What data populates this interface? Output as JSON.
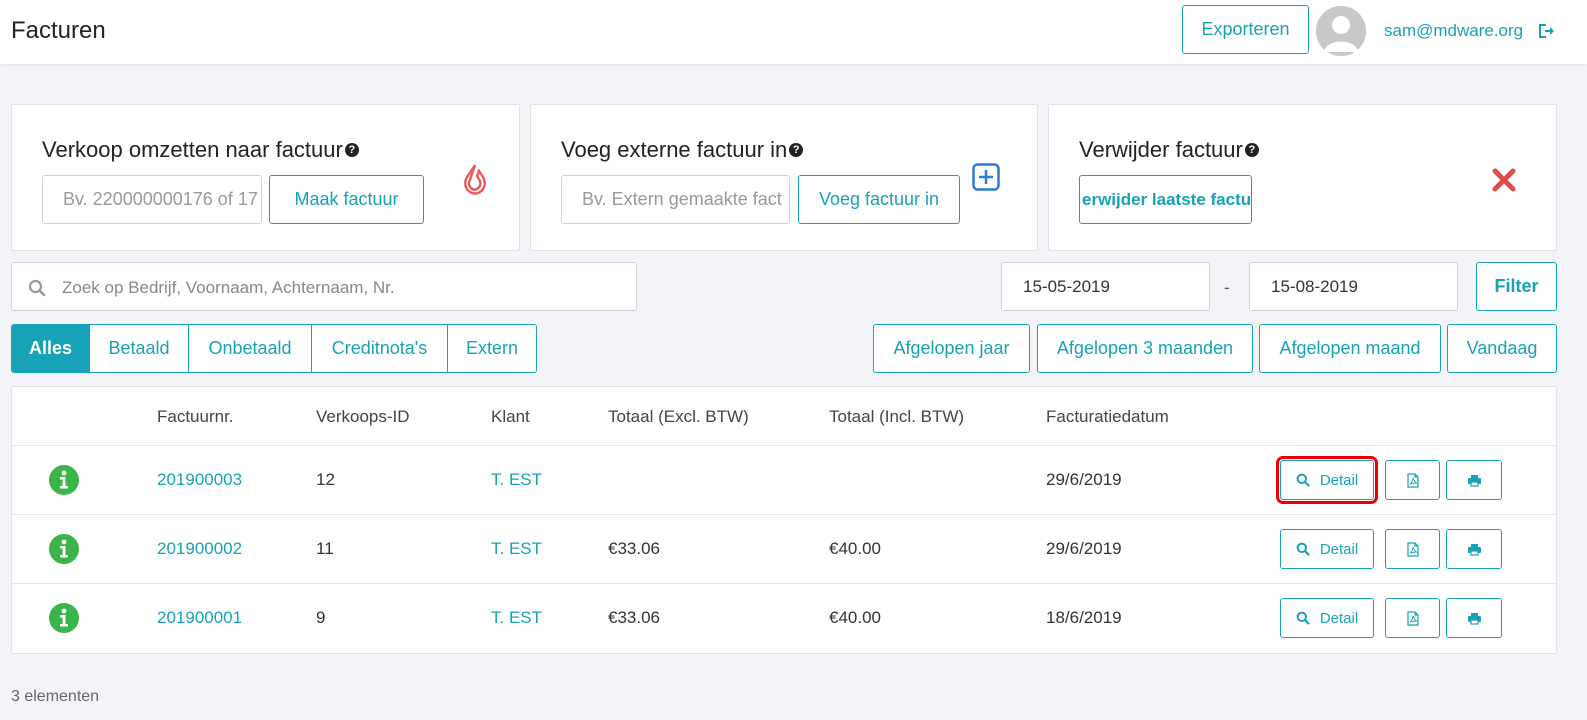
{
  "header": {
    "title": "Facturen",
    "export_label": "Exporteren",
    "user_email": "sam@mdware.org"
  },
  "cards": {
    "convert": {
      "title": "Verkoop omzetten naar factuur",
      "placeholder": "Bv. 220000000176 of 17",
      "button": "Maak factuur"
    },
    "external": {
      "title": "Voeg externe factuur in",
      "placeholder": "Bv. Extern gemaakte fact",
      "button": "Voeg factuur in"
    },
    "delete": {
      "title": "Verwijder factuur",
      "button": "erwijder laatste factuu"
    }
  },
  "search": {
    "placeholder": "Zoek op Bedrijf, Voornaam, Achternaam, Nr."
  },
  "date_filter": {
    "from": "15-05-2019",
    "separator": "-",
    "to": "15-08-2019",
    "filter_label": "Filter"
  },
  "tabs": [
    {
      "label": "Alles",
      "active": true
    },
    {
      "label": "Betaald",
      "active": false
    },
    {
      "label": "Onbetaald",
      "active": false
    },
    {
      "label": "Creditnota's",
      "active": false
    },
    {
      "label": "Extern",
      "active": false
    }
  ],
  "ranges": [
    "Afgelopen jaar",
    "Afgelopen 3 maanden",
    "Afgelopen maand",
    "Vandaag"
  ],
  "table": {
    "headers": [
      "Factuurnr.",
      "Verkoops-ID",
      "Klant",
      "Totaal (Excl. BTW)",
      "Totaal (Incl. BTW)",
      "Facturatiedatum"
    ],
    "detail_label": "Detail",
    "rows": [
      {
        "nr": "201900003",
        "sale_id": "12",
        "client": "T. EST",
        "excl": "",
        "incl": "",
        "date": "29/6/2019"
      },
      {
        "nr": "201900002",
        "sale_id": "11",
        "client": "T. EST",
        "excl": "€33.06",
        "incl": "€40.00",
        "date": "29/6/2019"
      },
      {
        "nr": "201900001",
        "sale_id": "9",
        "client": "T. EST",
        "excl": "€33.06",
        "incl": "€40.00",
        "date": "18/6/2019"
      }
    ]
  },
  "footer": {
    "count": "3 elementen"
  },
  "colors": {
    "accent": "#17a2b8",
    "info": "#3bb54a",
    "danger": "#e04b4b",
    "logo": "#e95a5a",
    "plus": "#2f7ad1"
  }
}
